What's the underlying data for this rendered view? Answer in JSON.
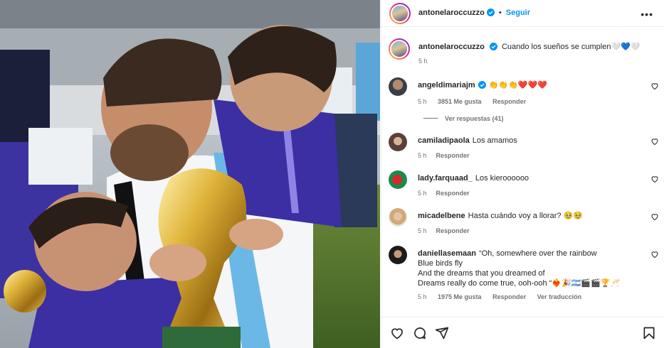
{
  "post": {
    "author": "antonelaroccuzzo",
    "follow_label": "Seguir",
    "more_label": "•••",
    "caption_author": "antonelaroccuzzo",
    "caption": "Cuando los sueños se cumplen🤍💙🤍",
    "caption_time": "5 h"
  },
  "comments": [
    {
      "user": "angeldimariajm",
      "verified": true,
      "text": "👏👏👏❤️❤️❤️",
      "time": "5 h",
      "likes": "3851 Me gusta",
      "reply": "Responder",
      "view_replies": "Ver respuestas (41)"
    },
    {
      "user": "camiladipaola",
      "text": "Los amamos",
      "time": "5 h",
      "reply": "Responder"
    },
    {
      "user": "lady.farquaad_",
      "text": "Los kieroooooo",
      "time": "5 h",
      "reply": "Responder"
    },
    {
      "user": "micadelbene",
      "text": "Hasta cuándo voy a llorar? 🥹🥹",
      "time": "5 h",
      "reply": "Responder"
    },
    {
      "user": "daniellasemaan",
      "lines": [
        "“Oh, somewhere over the rainbow",
        "Blue birds fly",
        "And the dreams that you dreamed of",
        "Dreams really do come true, ooh-ooh “❤️‍🔥🎉🇦🇷🎬🎬🏆🥂"
      ],
      "time": "5 h",
      "likes": "1975 Me gusta",
      "reply": "Responder",
      "translate": "Ver traducción"
    }
  ],
  "icons": {
    "like": "heart-icon",
    "comment": "comment-icon",
    "share": "share-icon",
    "save": "bookmark-icon",
    "verified": "verified-badge-icon",
    "more": "more-options-icon"
  },
  "colors": {
    "link": "#0095f6",
    "secondary_text": "#737373",
    "verified": "#0095f6",
    "heart_red": "#ed4956"
  }
}
